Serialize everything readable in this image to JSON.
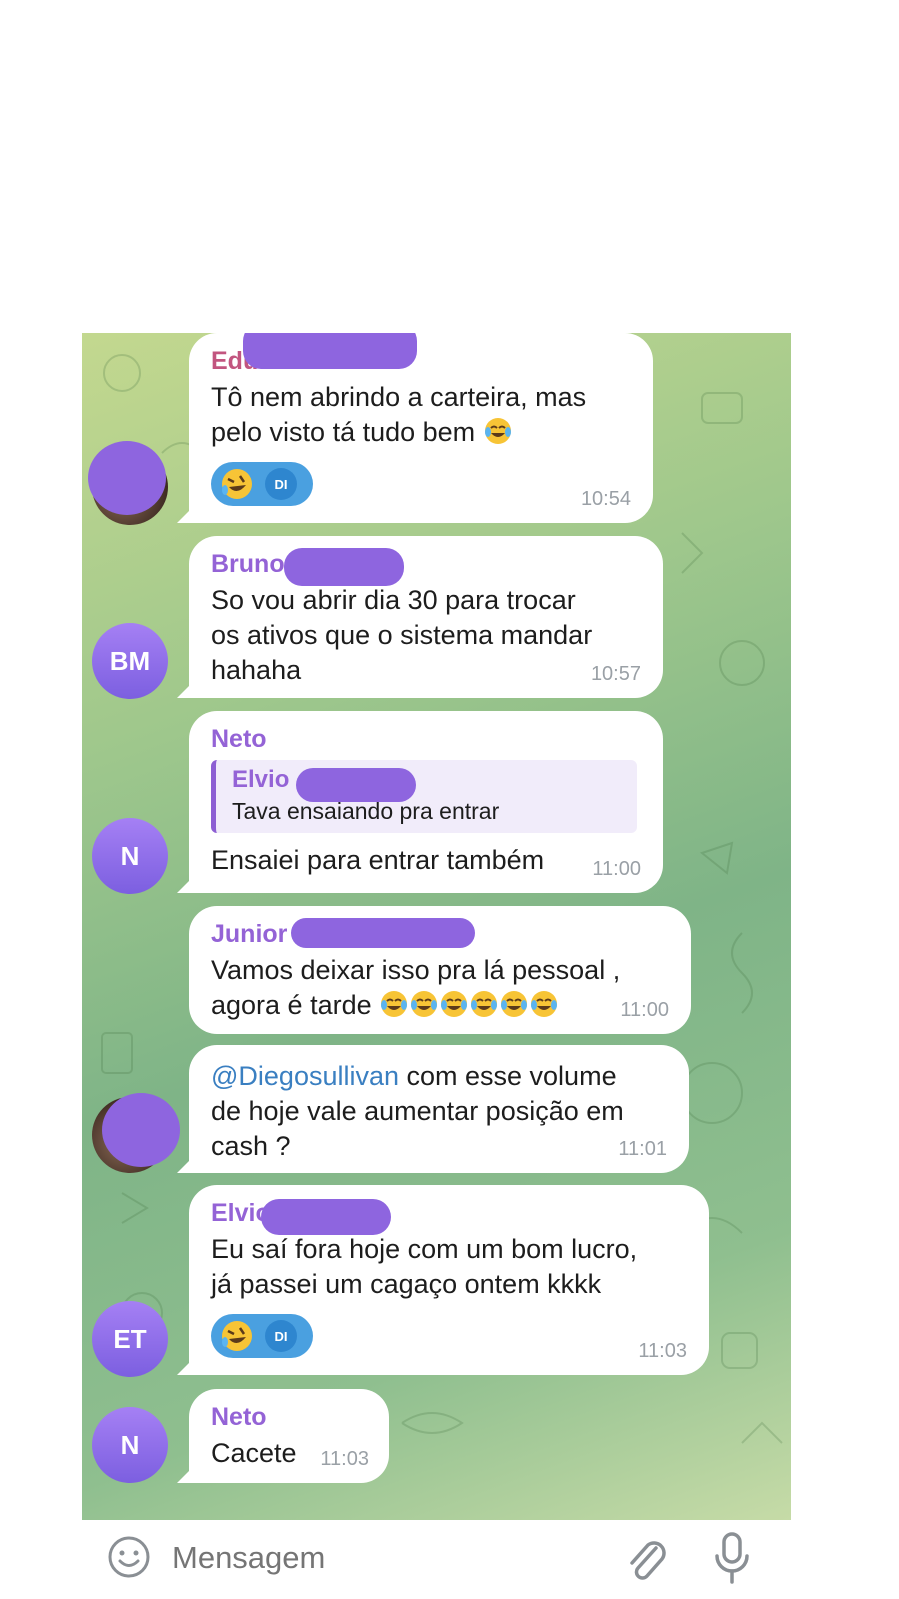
{
  "messages": [
    {
      "sender": "Edu",
      "text_line1": "Tô nem abrindo a carteira, mas",
      "text_line2": "pelo visto tá tudo bem",
      "reaction_avatar": "DI",
      "time": "10:54"
    },
    {
      "sender": "Bruno",
      "text_lines": [
        "So vou abrir dia 30 para trocar",
        "os ativos que o sistema mandar",
        "hahaha"
      ],
      "avatar": "BM",
      "time": "10:57"
    },
    {
      "sender": "Neto",
      "quote_sender": "Elvio",
      "quote_text": "Tava ensaiando pra entrar",
      "text": "Ensaiei para entrar também",
      "avatar": "N",
      "time": "11:00"
    },
    {
      "sender": "Junior",
      "text_line1": "Vamos deixar isso pra lá pessoal ,",
      "text_line2": "agora é tarde",
      "time": "11:00"
    },
    {
      "mention": "@Diegosullivan",
      "text_line1": " com esse volume",
      "text_line2": "de hoje vale aumentar posição em",
      "text_line3": "cash ?",
      "time": "11:01"
    },
    {
      "sender": "Elvio",
      "text_line1": "Eu saí fora hoje com um bom lucro,",
      "text_line2": "já passei um cagaço ontem kkkk",
      "reaction_avatar": "DI",
      "avatar": "ET",
      "time": "11:03"
    },
    {
      "sender": "Neto",
      "text": "Cacete",
      "avatar": "N",
      "time": "11:03"
    }
  ],
  "composer": {
    "placeholder": "Mensagem"
  },
  "colors": {
    "sender_purple": "#9463d6",
    "sender_pink": "#c2557f",
    "mention_blue": "#3a7fc1",
    "reaction_blue": "#4aa0e0",
    "redaction": "#8e65df"
  }
}
